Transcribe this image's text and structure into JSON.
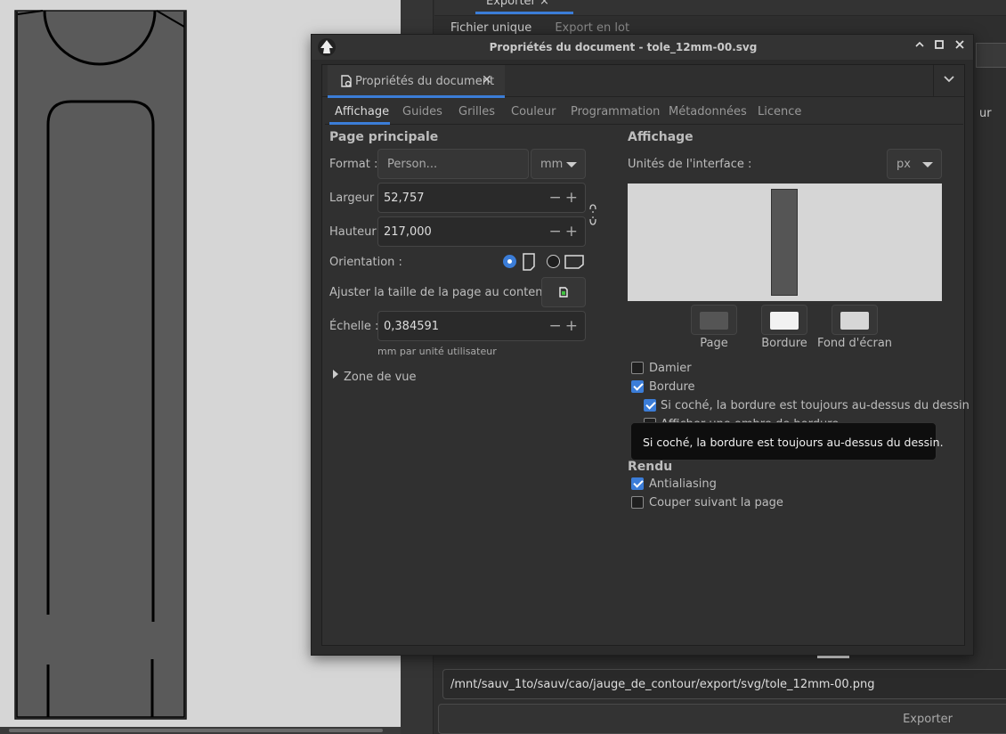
{
  "colors": {
    "accent": "#3b7dd8",
    "page": "#555555",
    "border": "#f2f2f2",
    "desk": "#d6d6d6"
  },
  "dock": {
    "export_tab_label": "Exporter",
    "mode_single": "Fichier unique",
    "mode_batch": "Export en lot",
    "side_label": "ur",
    "export_path": "/mnt/sauv_1to/sauv/cao/jauge_de_contour/export/svg/tole_12mm-00.png",
    "export_button": "Exporter"
  },
  "dialog": {
    "title": "Propriétés du document - tole_12mm-00.svg",
    "tab_label": "Propriétés du document",
    "subtabs": [
      "Affichage",
      "Guides",
      "Grilles",
      "Couleur",
      "Programmation",
      "Métadonnées",
      "Licence"
    ],
    "page": {
      "heading": "Page principale",
      "format_label": "Format :",
      "format_value": "Person...",
      "unit_value": "mm",
      "width_label": "Largeur :",
      "width_value": "52,757",
      "height_label": "Hauteur :",
      "height_value": "217,000",
      "orientation_label": "Orientation :",
      "fit_label": "Ajuster la taille de la page au contenu :",
      "scale_label": "Échelle :",
      "scale_value": "0,384591",
      "scale_hint": "mm par unité utilisateur",
      "viewbox_label": "Zone de vue"
    },
    "display": {
      "heading": "Affichage",
      "units_label": "Unités de l'interface :",
      "units_value": "px",
      "swatch_page": "Page",
      "swatch_border": "Bordure",
      "swatch_desk": "Fond d'écran",
      "checker": "Damier",
      "border": "Bordure",
      "border_on_top": "Si coché, la bordure est toujours au-dessus du dessin",
      "border_shadow": "Afficher une ombre de bordure",
      "render_heading": "Rendu",
      "antialias": "Antialiasing",
      "clip": "Couper suivant la page"
    },
    "tooltip": "Si coché, la bordure est toujours au-dessus du dessin."
  }
}
